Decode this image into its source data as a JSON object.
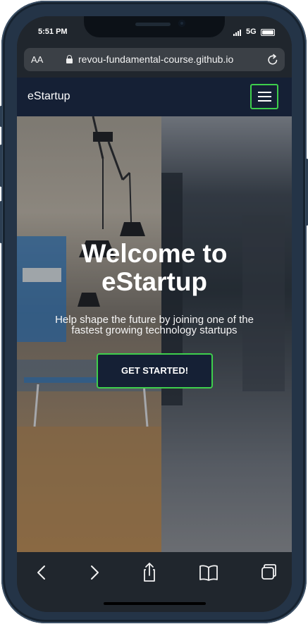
{
  "status": {
    "time": "5:51 PM",
    "network": "5G"
  },
  "browser": {
    "text_size_label": "AA",
    "url": "revou-fundamental-course.github.io"
  },
  "site": {
    "brand": "eStartup",
    "hero": {
      "title_line1": "Welcome to",
      "title_line2": "eStartup",
      "subtitle_line1": "Help shape the future by joining one of the",
      "subtitle_line2": "fastest growing technology startups",
      "cta_label": "GET STARTED!"
    }
  },
  "colors": {
    "accent": "#3ecf4c",
    "navbar": "#152035",
    "browser_chrome": "#20262d"
  },
  "icons": [
    "lock-icon",
    "reload-icon",
    "hamburger-menu-icon",
    "back-icon",
    "forward-icon",
    "share-icon",
    "bookmarks-icon",
    "tabs-icon"
  ]
}
